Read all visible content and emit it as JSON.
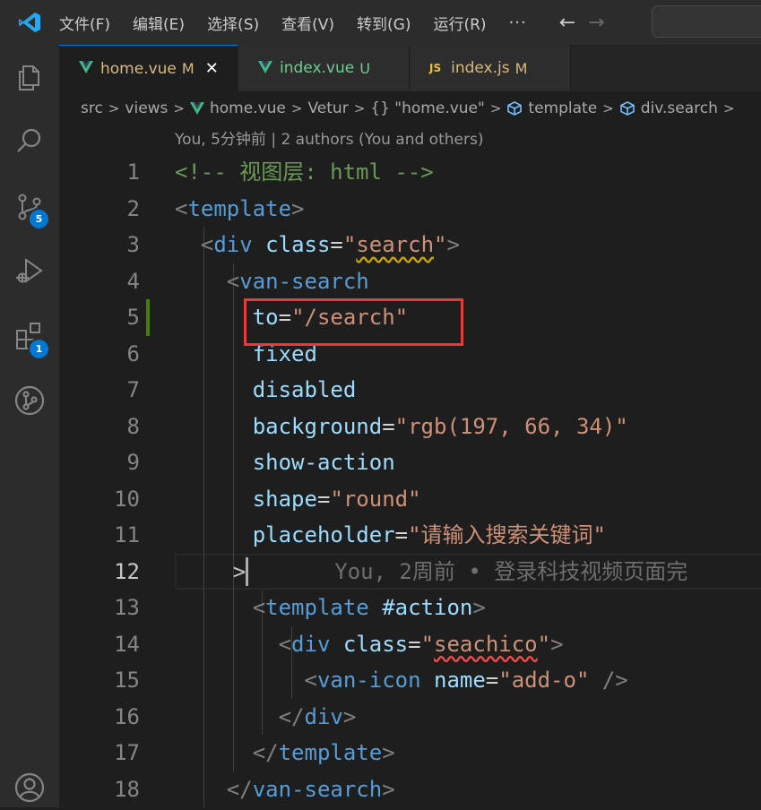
{
  "titlebar": {
    "menu": [
      "文件(F)",
      "编辑(E)",
      "选择(S)",
      "查看(V)",
      "转到(G)",
      "运行(R)"
    ],
    "more": "···",
    "back": "←",
    "forward": "→"
  },
  "activity_bar": {
    "icons": [
      "explorer-icon",
      "search-icon",
      "source-control-icon",
      "run-debug-icon",
      "extensions-icon",
      "git-graph-icon",
      "account-icon"
    ],
    "scm_badge": "5",
    "extensions_badge": "1"
  },
  "tabs": [
    {
      "name": "home.vue",
      "status": "M",
      "close": "✕",
      "icon": "vue-icon"
    },
    {
      "name": "index.vue",
      "status": "U",
      "icon": "vue-icon"
    },
    {
      "name": "index.js",
      "status": "M",
      "icon": "js-icon",
      "icon_text": "JS"
    }
  ],
  "breadcrumb": {
    "items": [
      "src",
      "views",
      "home.vue",
      "Vetur",
      "{} \"home.vue\"",
      "template",
      "div.search"
    ]
  },
  "editor": {
    "codelens": "You, 5分钟前 | 2 authors (You and others)",
    "line_numbers": [
      "1",
      "2",
      "3",
      "4",
      "5",
      "6",
      "7",
      "8",
      "9",
      "10",
      "11",
      "12",
      "13",
      "14",
      "15",
      "16",
      "17",
      "18"
    ],
    "current_line": "12",
    "blame": "You, 2周前 • 登录科技视频页面完",
    "fold_marker": ">",
    "lines": [
      [
        [
          "cmt",
          "<!-- 视图层: html -->"
        ]
      ],
      [
        [
          "pun",
          "<"
        ],
        [
          "tag",
          "template"
        ],
        [
          "pun",
          ">"
        ]
      ],
      [
        [
          "txt",
          "  "
        ],
        [
          "pun",
          "<"
        ],
        [
          "tag",
          "div"
        ],
        [
          "txt",
          " "
        ],
        [
          "att",
          "class"
        ],
        [
          "txt",
          "="
        ],
        [
          "str",
          "\""
        ],
        [
          "str-sq",
          "search"
        ],
        [
          "str",
          "\""
        ],
        [
          "pun",
          ">"
        ]
      ],
      [
        [
          "txt",
          "    "
        ],
        [
          "pun",
          "<"
        ],
        [
          "tag",
          "van-search"
        ]
      ],
      [
        [
          "txt",
          "      "
        ],
        [
          "att",
          "to"
        ],
        [
          "txt",
          "="
        ],
        [
          "str",
          "\"/search\""
        ]
      ],
      [
        [
          "txt",
          "      "
        ],
        [
          "att",
          "fixed"
        ]
      ],
      [
        [
          "txt",
          "      "
        ],
        [
          "att",
          "disabled"
        ]
      ],
      [
        [
          "txt",
          "      "
        ],
        [
          "att",
          "background"
        ],
        [
          "txt",
          "="
        ],
        [
          "str",
          "\"rgb(197, 66, 34)\""
        ]
      ],
      [
        [
          "txt",
          "      "
        ],
        [
          "att",
          "show-action"
        ]
      ],
      [
        [
          "txt",
          "      "
        ],
        [
          "att",
          "shape"
        ],
        [
          "txt",
          "="
        ],
        [
          "str",
          "\"round\""
        ]
      ],
      [
        [
          "txt",
          "      "
        ],
        [
          "att",
          "placeholder"
        ],
        [
          "txt",
          "="
        ],
        [
          "str",
          "\"请输入搜索关键词\""
        ]
      ],
      [],
      [
        [
          "txt",
          "      "
        ],
        [
          "pun",
          "<"
        ],
        [
          "tag",
          "template"
        ],
        [
          "txt",
          " "
        ],
        [
          "att",
          "#action"
        ],
        [
          "pun",
          ">"
        ]
      ],
      [
        [
          "txt",
          "        "
        ],
        [
          "pun",
          "<"
        ],
        [
          "tag",
          "div"
        ],
        [
          "txt",
          " "
        ],
        [
          "att",
          "class"
        ],
        [
          "txt",
          "="
        ],
        [
          "str",
          "\""
        ],
        [
          "str-sqr",
          "seachico"
        ],
        [
          "str",
          "\""
        ],
        [
          "pun",
          ">"
        ]
      ],
      [
        [
          "txt",
          "          "
        ],
        [
          "pun",
          "<"
        ],
        [
          "tag",
          "van-icon"
        ],
        [
          "txt",
          " "
        ],
        [
          "att",
          "name"
        ],
        [
          "txt",
          "="
        ],
        [
          "str",
          "\"add-o\""
        ],
        [
          "txt",
          " "
        ],
        [
          "pun",
          "/>"
        ]
      ],
      [
        [
          "txt",
          "        "
        ],
        [
          "pun",
          "</"
        ],
        [
          "tag",
          "div"
        ],
        [
          "pun",
          ">"
        ]
      ],
      [
        [
          "txt",
          "      "
        ],
        [
          "pun",
          "</"
        ],
        [
          "tag",
          "template"
        ],
        [
          "pun",
          ">"
        ]
      ],
      [
        [
          "txt",
          "    "
        ],
        [
          "pun",
          "</"
        ],
        [
          "tag",
          "van-search"
        ],
        [
          "pun",
          ">"
        ]
      ]
    ]
  },
  "colors": {
    "accent": "#0078d4",
    "highlight_box": "#e53b3b",
    "git_modified": "#487e02"
  }
}
